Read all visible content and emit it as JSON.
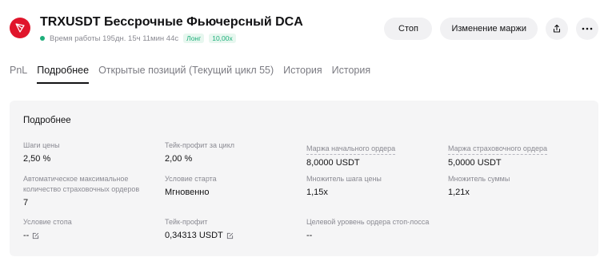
{
  "header": {
    "title": "TRXUSDT Бессрочные Фьючерсный DCA",
    "runtime": "Время работы 195дн. 15ч 11мин 44с",
    "side_badge": "Лонг",
    "leverage_badge": "10,00x",
    "logo_color": "#e0152b",
    "status_color": "#1dae7a"
  },
  "actions": {
    "stop_label": "Стоп",
    "margin_label": "Изменение маржи",
    "share_icon": "share-icon",
    "more_icon": "more-icon"
  },
  "tabs": [
    {
      "label": "PnL"
    },
    {
      "label": "Подробнее"
    },
    {
      "label": "Открытые позиций (Текущий цикл 55)"
    },
    {
      "label": "История"
    },
    {
      "label": "История"
    }
  ],
  "details": {
    "title": "Подробнее",
    "price_step": {
      "label": "Шаги цены",
      "value": "2,50 %"
    },
    "tp_per_cycle": {
      "label": "Тейк-профит за цикл",
      "value": "2,00 %"
    },
    "initial_margin": {
      "label": "Маржа начального ордера",
      "value": "8,0000 USDT"
    },
    "safety_margin": {
      "label": "Маржа страховочного ордера",
      "value": "5,0000 USDT"
    },
    "auto_max": {
      "label_line1": "Автоматическое максимальное",
      "label_line2": "количество страховочных ордеров",
      "value": "7"
    },
    "start_condition": {
      "label": "Условие старта",
      "value": "Мгновенно"
    },
    "step_multiplier": {
      "label": "Множитель шага цены",
      "value": "1,15x"
    },
    "amount_multiplier": {
      "label": "Множитель суммы",
      "value": "1,21x"
    },
    "stop_condition": {
      "label": "Условие стопа",
      "value": "--"
    },
    "take_profit": {
      "label": "Тейк-профит",
      "value": "0,34313 USDT"
    },
    "stop_loss_level": {
      "label": "Целевой уровень ордера стоп-лосса",
      "value": "--"
    }
  }
}
